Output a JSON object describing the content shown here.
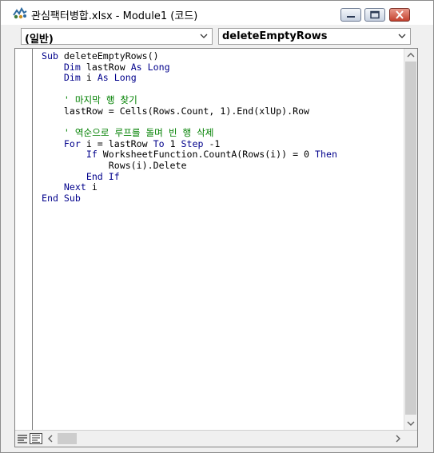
{
  "window": {
    "title": "관심팩터병합.xlsx - Module1 (코드)"
  },
  "title_buttons": {
    "minimize_icon": "minimize-icon",
    "restore_icon": "restore-icon",
    "close_icon": "close-icon"
  },
  "object_combo": {
    "value": "(일반)"
  },
  "procedure_combo": {
    "value": "deleteEmptyRows"
  },
  "code": {
    "lines": [
      [
        {
          "t": "kw",
          "v": "Sub "
        },
        {
          "t": "tx",
          "v": "deleteEmptyRows()"
        }
      ],
      [
        {
          "t": "kw",
          "v": "    Dim "
        },
        {
          "t": "tx",
          "v": "lastRow "
        },
        {
          "t": "kw",
          "v": "As Long"
        }
      ],
      [
        {
          "t": "kw",
          "v": "    Dim "
        },
        {
          "t": "tx",
          "v": "i "
        },
        {
          "t": "kw",
          "v": "As Long"
        }
      ],
      [],
      [
        {
          "t": "cm",
          "v": "    ' 마지막 행 찾기"
        }
      ],
      [
        {
          "t": "tx",
          "v": "    lastRow = Cells(Rows.Count, 1).End(xlUp).Row"
        }
      ],
      [],
      [
        {
          "t": "cm",
          "v": "    ' 역순으로 루프를 돌며 빈 행 삭제"
        }
      ],
      [
        {
          "t": "kw",
          "v": "    For "
        },
        {
          "t": "tx",
          "v": "i = lastRow "
        },
        {
          "t": "kw",
          "v": "To "
        },
        {
          "t": "tx",
          "v": "1 "
        },
        {
          "t": "kw",
          "v": "Step "
        },
        {
          "t": "tx",
          "v": "-1"
        }
      ],
      [
        {
          "t": "kw",
          "v": "        If "
        },
        {
          "t": "tx",
          "v": "WorksheetFunction.CountA(Rows(i)) = 0 "
        },
        {
          "t": "kw",
          "v": "Then"
        }
      ],
      [
        {
          "t": "tx",
          "v": "            Rows(i).Delete"
        }
      ],
      [
        {
          "t": "kw",
          "v": "        End If"
        }
      ],
      [
        {
          "t": "kw",
          "v": "    Next "
        },
        {
          "t": "tx",
          "v": "i"
        }
      ],
      [
        {
          "t": "kw",
          "v": "End Sub"
        }
      ]
    ]
  },
  "bottom_bar": {
    "procedure_view_icon": "procedure-view-icon",
    "full_module_view_icon": "full-module-view-icon"
  },
  "colors": {
    "keyword": "#00008b",
    "comment": "#008000",
    "text": "#000000"
  }
}
